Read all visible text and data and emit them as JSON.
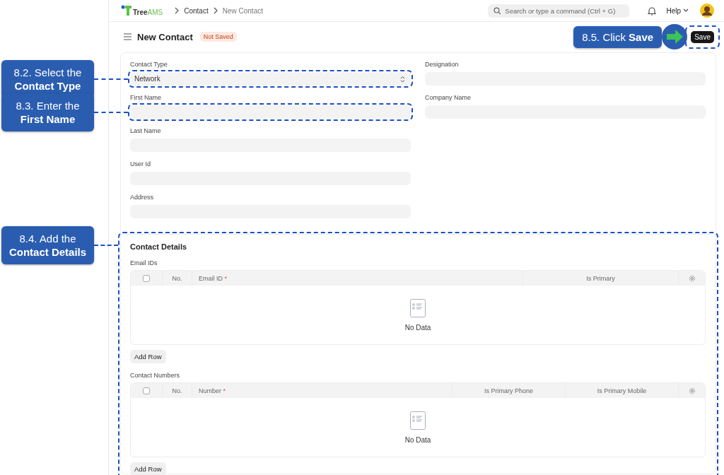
{
  "navbar": {
    "logo": {
      "part1": "Tree",
      "part2": "AMS"
    },
    "breadcrumbs": [
      "Contact",
      "New Contact"
    ],
    "search": {
      "placeholder": "Search or type a command (Ctrl + G)"
    },
    "help": "Help"
  },
  "page_header": {
    "title": "New Contact",
    "status": "Not Saved",
    "save_button": {
      "label": "Save",
      "callout": {
        "text": "8.5. Click **Save**",
        "kind": "arrow"
      }
    }
  },
  "form": {
    "columns": [
      [
        {
          "label": "Contact Type",
          "kind": "select",
          "value": "Network",
          "callout": {
            "text": "8.2. Select the **Contact Type**",
            "kind": "leader"
          }
        },
        {
          "label": "First Name",
          "kind": "text",
          "callout": {
            "text": "8.3. Enter the **First Name**",
            "kind": "leader"
          }
        },
        {
          "label": "Last Name",
          "kind": "text"
        },
        {
          "label": "User Id",
          "kind": "text"
        },
        {
          "label": "Address",
          "kind": "text"
        }
      ],
      [
        {
          "label": "Designation",
          "kind": "text"
        },
        {
          "label": "Company Name",
          "kind": "text"
        }
      ]
    ]
  },
  "section": {
    "title": "Contact Details",
    "callout": {
      "text": "8.4. Add the **Contact Details**",
      "kind": "leader"
    },
    "tables": [
      {
        "label": "Email IDs",
        "select_all_checked": false,
        "no_label": "No.",
        "columns": [
          {
            "label": "Email ID",
            "required_mark": "*"
          },
          {
            "label": "Is Primary"
          }
        ],
        "empty_text": "No Data",
        "add_button": "Add Row"
      },
      {
        "label": "Contact Numbers",
        "select_all_checked": false,
        "no_label": "No.",
        "columns": [
          {
            "label": "Number",
            "required_mark": "*"
          },
          {
            "label": "Is Primary Phone"
          },
          {
            "label": "Is Primary Mobile"
          }
        ],
        "empty_text": "No Data",
        "add_button": "Add Row"
      }
    ]
  }
}
